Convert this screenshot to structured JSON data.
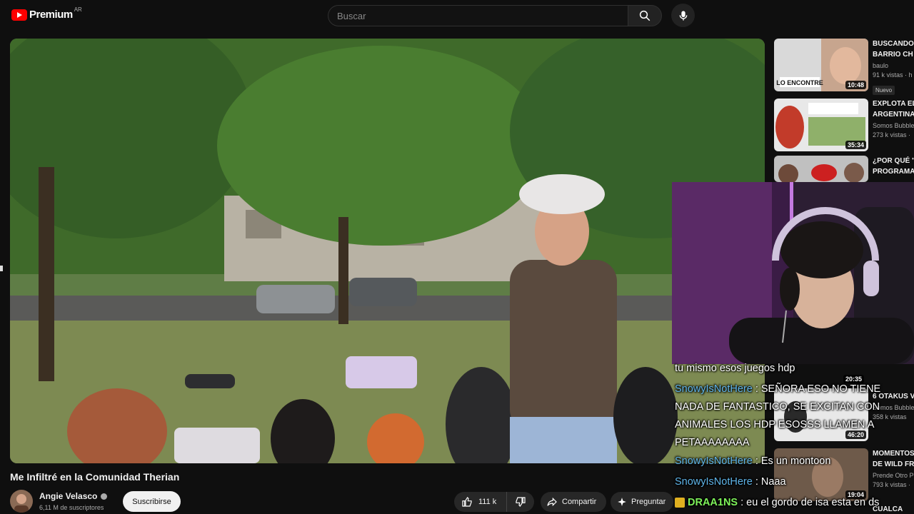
{
  "header": {
    "logo_text": "Premium",
    "country": "AR",
    "search_placeholder": "Buscar"
  },
  "video": {
    "title": "Me Infiltré en la Comunidad Therian",
    "channel": "Angie Velasco",
    "subscribers": "6,11 M de suscriptores",
    "subscribe_label": "Suscribirse",
    "likes": "111 k",
    "share_label": "Compartir",
    "ask_label": "Preguntar"
  },
  "recommendations": [
    {
      "title": "BUSCANDO",
      "title2": "BARRIO CH",
      "channel": "baulo",
      "views": "91 k vistas · h",
      "duration": "10:48",
      "badge": "Nuevo",
      "thumb_text": "LO ENCONTRE",
      "thumb_color": "#d9d9d9"
    },
    {
      "title": "EXPLOTA EL",
      "title2": "ARGENTINA",
      "channel": "Somos Bubble",
      "views": "273 k vistas ·",
      "duration": "35:34",
      "thumb_color": "#e8e8e8"
    },
    {
      "title": "¿POR QUÉ \"",
      "title2": "PROGRAMA",
      "channel": "",
      "views": "",
      "duration": "",
      "thumb_color": "#c0c0c0"
    },
    {
      "title": "6 OTAKUS V",
      "title2": "",
      "channel": "Somos Bubble",
      "views": "358 k vistas",
      "duration": "46:20",
      "thumb_color": "#e8e8e8"
    },
    {
      "title": "MOMENTOS",
      "title2": "DE WILD FR",
      "channel": "Prende Otro P",
      "views": "793 k vistas ·",
      "duration": "19:04",
      "thumb_color": "#6e5a4a"
    },
    {
      "title": "CUALCA",
      "title2": "",
      "channel": "",
      "views": "",
      "duration": "",
      "thumb_color": "#333333"
    }
  ],
  "overlay_duration": "20:35",
  "chat": [
    {
      "user": "",
      "text": "tu mismo esos juegos hdp"
    },
    {
      "user": "SnowyIsNotHere",
      "text": " : SEÑORA ESO NO TIENE NADA DE FANTASTICO, SE EXCITAN CON ANIMALES LOS HDP ESOSSS LLAMEN A PETAAAAAAAA"
    },
    {
      "user": "SnowyIsNotHere",
      "text": " : Es un montoon"
    },
    {
      "user": "SnowyIsNotHere",
      "text": " : Naaa"
    },
    {
      "user": "DRAA1NS",
      "text": " : eu el gordo de isa esta en ds"
    }
  ],
  "colors": {
    "accent": "#ff0000",
    "chat_user": "#5fb4e8",
    "chat_user_alt": "#7ef25a"
  }
}
